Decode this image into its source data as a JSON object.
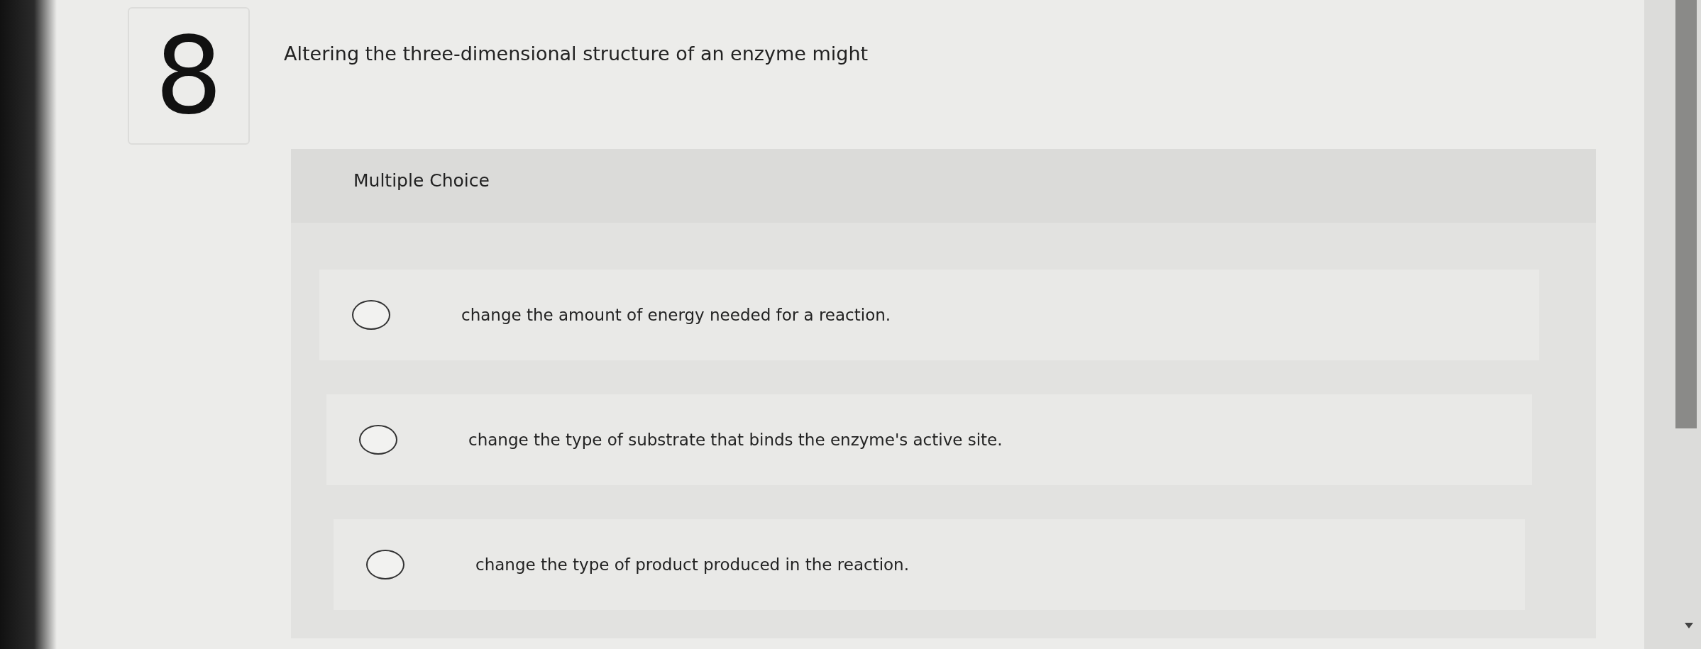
{
  "question": {
    "number": "8",
    "prompt": "Altering the three-dimensional structure of an enzyme might"
  },
  "answer_panel": {
    "format": "Multiple Choice",
    "options": [
      {
        "text": "change the amount of energy needed for a reaction.",
        "selected": false
      },
      {
        "text": "change the type of substrate that binds the enzyme's active site.",
        "selected": false
      },
      {
        "text": "change the type of product produced in the reaction.",
        "selected": false
      }
    ]
  }
}
